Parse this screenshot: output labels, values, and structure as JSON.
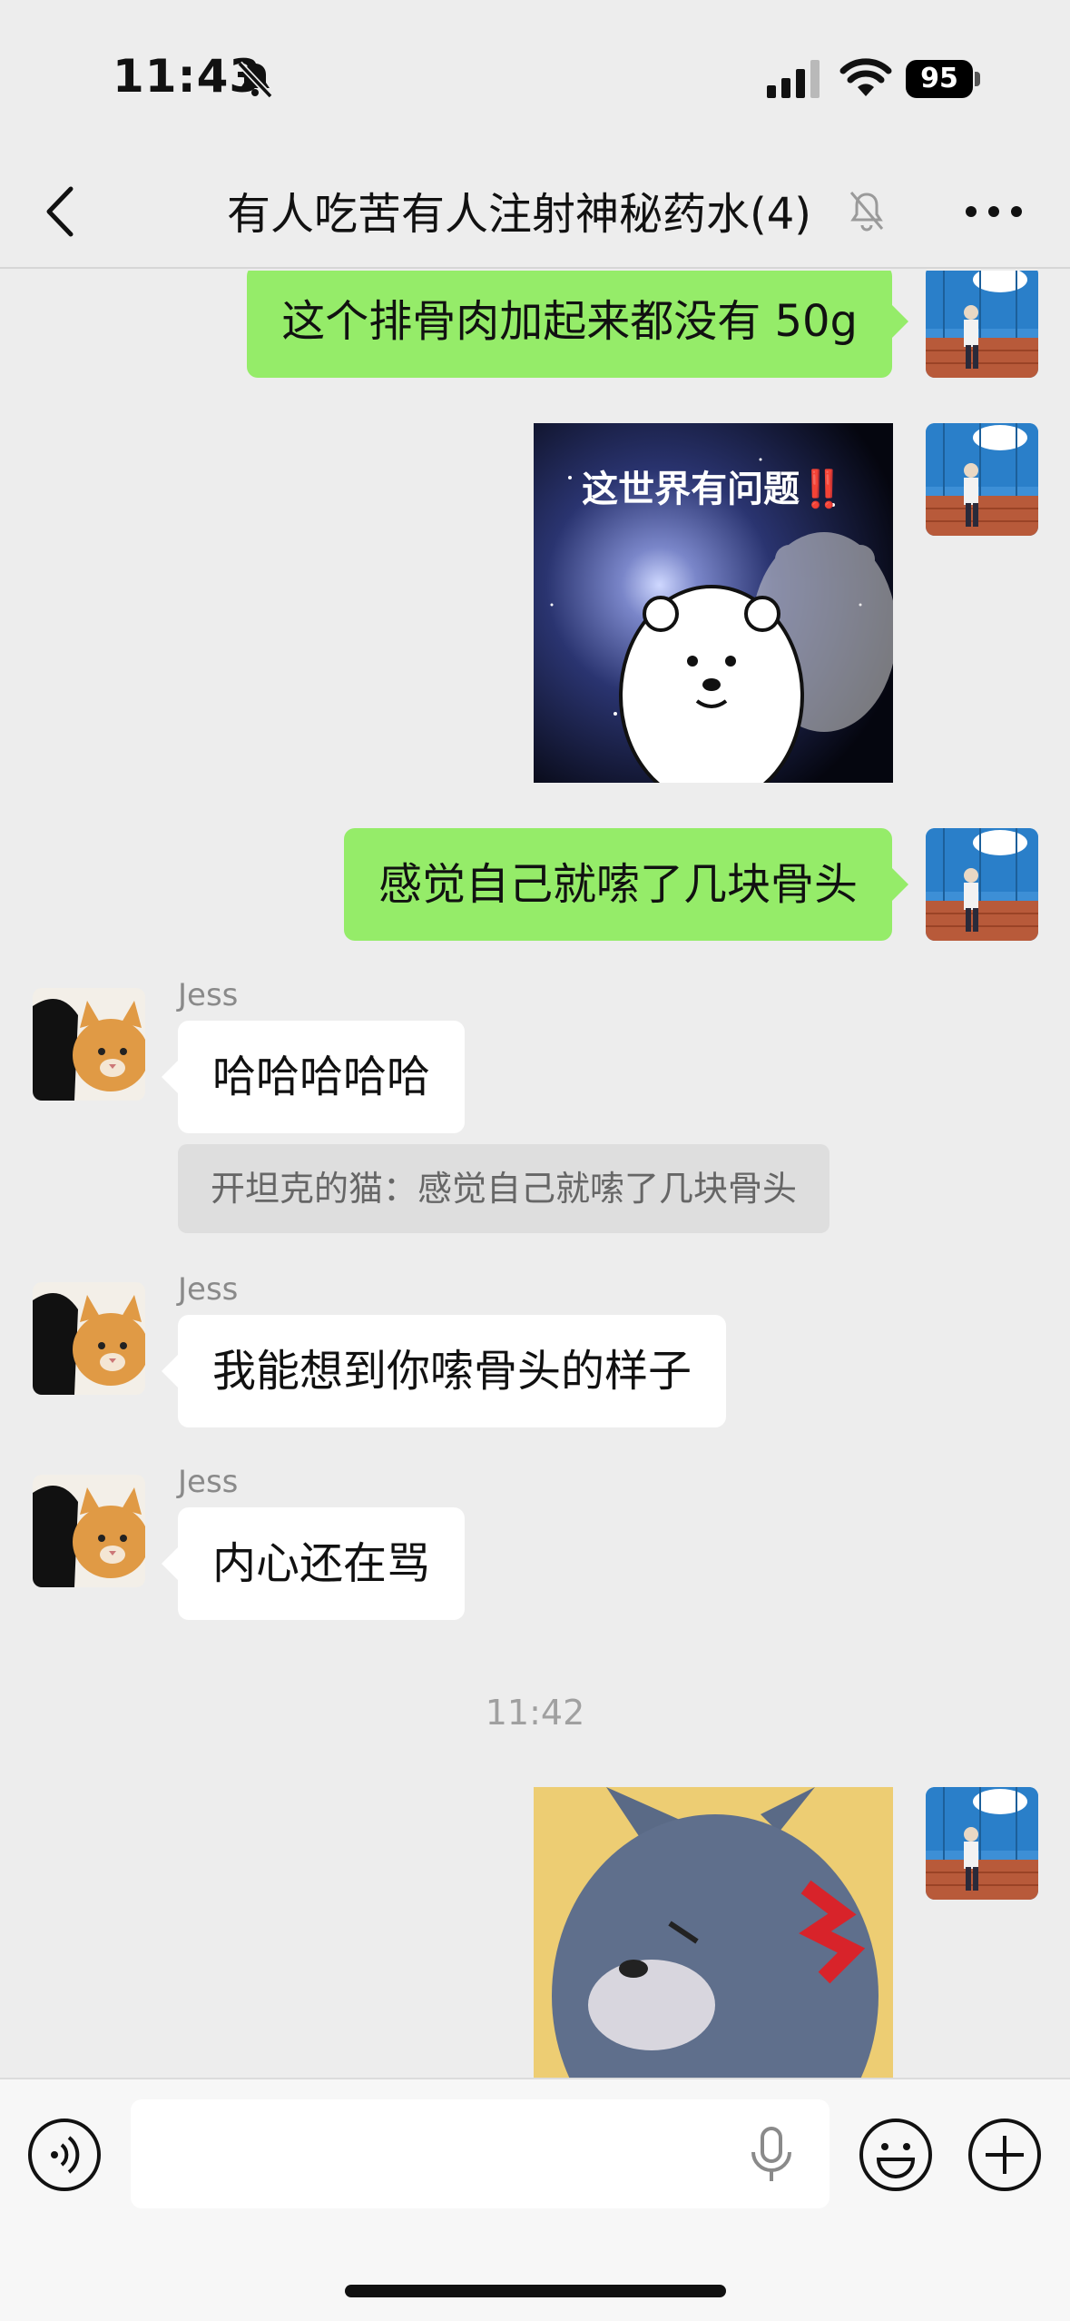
{
  "status_bar": {
    "time": "11:43",
    "battery": "95"
  },
  "nav": {
    "title": "有人吃苦有人注射神秘药水(4)"
  },
  "messages": [
    {
      "type": "text",
      "side": "me",
      "text": "这个排骨肉加起来都没有 50g"
    },
    {
      "type": "sticker",
      "side": "me",
      "caption": "这世界有问题‼️"
    },
    {
      "type": "text",
      "side": "me",
      "text": "感觉自己就嗦了几块骨头"
    },
    {
      "type": "text",
      "side": "other",
      "sender": "Jess",
      "text": "哈哈哈哈哈",
      "quote": "开坦克的猫：感觉自己就嗦了几块骨头"
    },
    {
      "type": "text",
      "side": "other",
      "sender": "Jess",
      "text": "我能想到你嗦骨头的样子"
    },
    {
      "type": "text",
      "side": "other",
      "sender": "Jess",
      "text": "内心还在骂"
    },
    {
      "type": "timestamp",
      "text": "11:42"
    },
    {
      "type": "sticker",
      "side": "me"
    }
  ],
  "input_bar": {
    "placeholder": ""
  },
  "colors": {
    "my_bubble": "#95ec69",
    "other_bubble": "#ffffff",
    "background": "#ededed"
  }
}
